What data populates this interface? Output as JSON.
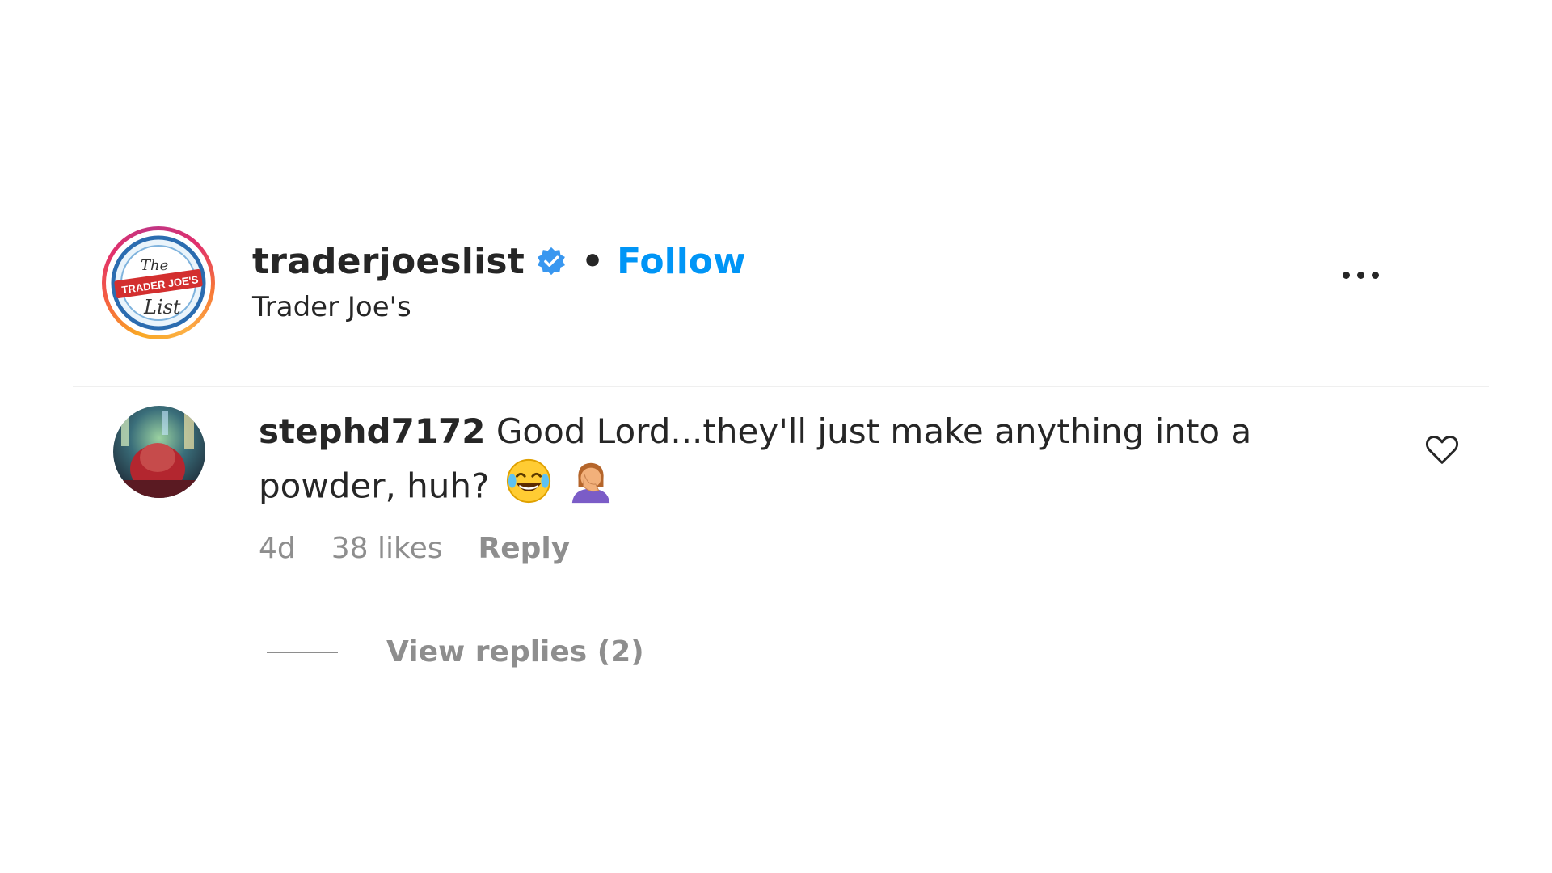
{
  "post": {
    "username": "traderjoeslist",
    "verified_icon": "verified-badge-icon",
    "separator": "•",
    "follow_label": "Follow",
    "location": "Trader Joe's",
    "more_icon": "more-options-icon",
    "avatar_logo_text": [
      "The",
      "TRADER JOE'S",
      "List"
    ]
  },
  "comment": {
    "username": "stephd7172",
    "text": "Good Lord...they'll just make anything into a powder, huh?",
    "emojis": [
      "face-with-tears-of-joy-icon",
      "woman-facepalming-icon"
    ],
    "age": "4d",
    "likes": "38 likes",
    "reply_label": "Reply",
    "view_replies_label": "View replies (2)",
    "like_icon": "heart-outline-icon"
  },
  "colors": {
    "accent": "#0095f6",
    "text": "#262626",
    "muted": "#8e8e8e"
  }
}
